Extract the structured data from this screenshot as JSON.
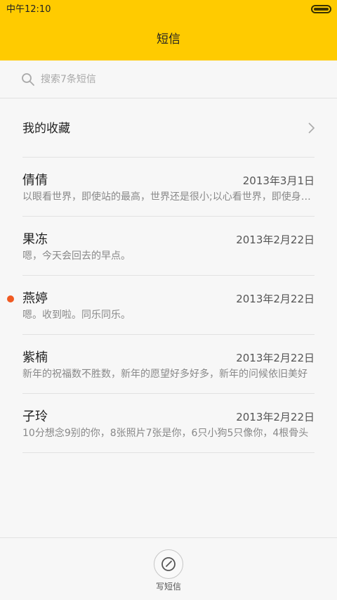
{
  "status_bar": {
    "time": "中午12:10"
  },
  "header": {
    "title": "短信",
    "accent_color": "#ffcb00"
  },
  "search": {
    "placeholder": "搜索7条短信"
  },
  "favorites": {
    "label": "我的收藏"
  },
  "messages": [
    {
      "name": "倩倩",
      "date": "2013年3月1日",
      "preview": "以眼看世界，即使站的最高，世界还是很小;以心看世界，即使身处最低，世界也是很大",
      "unread": false
    },
    {
      "name": "果冻",
      "date": "2013年2月22日",
      "preview": "嗯，今天会回去的早点。",
      "unread": false
    },
    {
      "name": "燕婷",
      "date": "2013年2月22日",
      "preview": "嗯。收到啦。同乐同乐。",
      "unread": true
    },
    {
      "name": "紫楠",
      "date": "2013年2月22日",
      "preview": "新年的祝福数不胜数，新年的愿望好多好多，新年的问候依旧美好",
      "unread": false
    },
    {
      "name": "子玲",
      "date": "2013年2月22日",
      "preview": "10分想念9别的你，8张照片7张是你，6只小狗5只像你，4根骨头",
      "unread": false
    }
  ],
  "compose": {
    "label": "写短信"
  },
  "unread_color": "#f05a22"
}
